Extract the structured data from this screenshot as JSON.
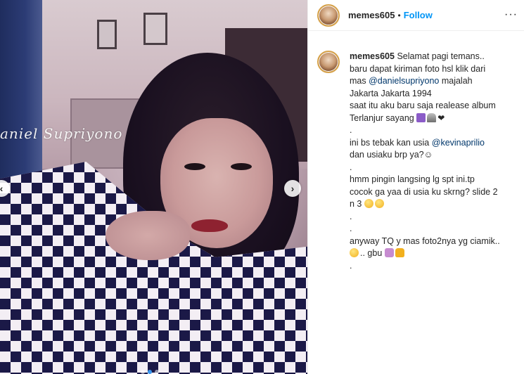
{
  "post": {
    "username": "memes605",
    "separator": "•",
    "follow_label": "Follow",
    "more_label": "···",
    "watermark": "aniel Supriyono"
  },
  "carousel": {
    "prev_label": "‹",
    "next_label": "›",
    "slide_count": 3,
    "active_slide": 2
  },
  "caption": {
    "username": "memes605",
    "line1": "Selamat pagi temans..",
    "line2": "baru dapat kiriman foto hsl klik dari",
    "line3_prefix": "mas ",
    "line3_mention": "@danielsupriyono",
    "line3_suffix": " majalah",
    "line4": "Jakarta Jakarta 1994",
    "line5": "saat itu aku baru saja realease album",
    "line6": "Terlanjur sayang",
    "dot1": ".",
    "line7_prefix": "ini bs tebak kan usia ",
    "line7_mention": "@kevinaprilio",
    "line8": "dan usiaku brp ya?☺",
    "dot2": ".",
    "line9": "hmm pingin langsing lg spt ini.tp",
    "line10": "cocok ga yaa di usia ku skrng? slide 2",
    "line11": "n 3",
    "dot3": ".",
    "dot4": ".",
    "line12": "anyway TQ y mas foto2nya yg ciamik..",
    "line13": ".. gbu",
    "dot5": "."
  },
  "colors": {
    "follow": "#0095f6",
    "mention": "#00376b",
    "text": "#262626"
  },
  "icons": [
    "avatar-icon",
    "more-options-icon",
    "prev-arrow-icon",
    "next-arrow-icon",
    "emoji-icon"
  ]
}
